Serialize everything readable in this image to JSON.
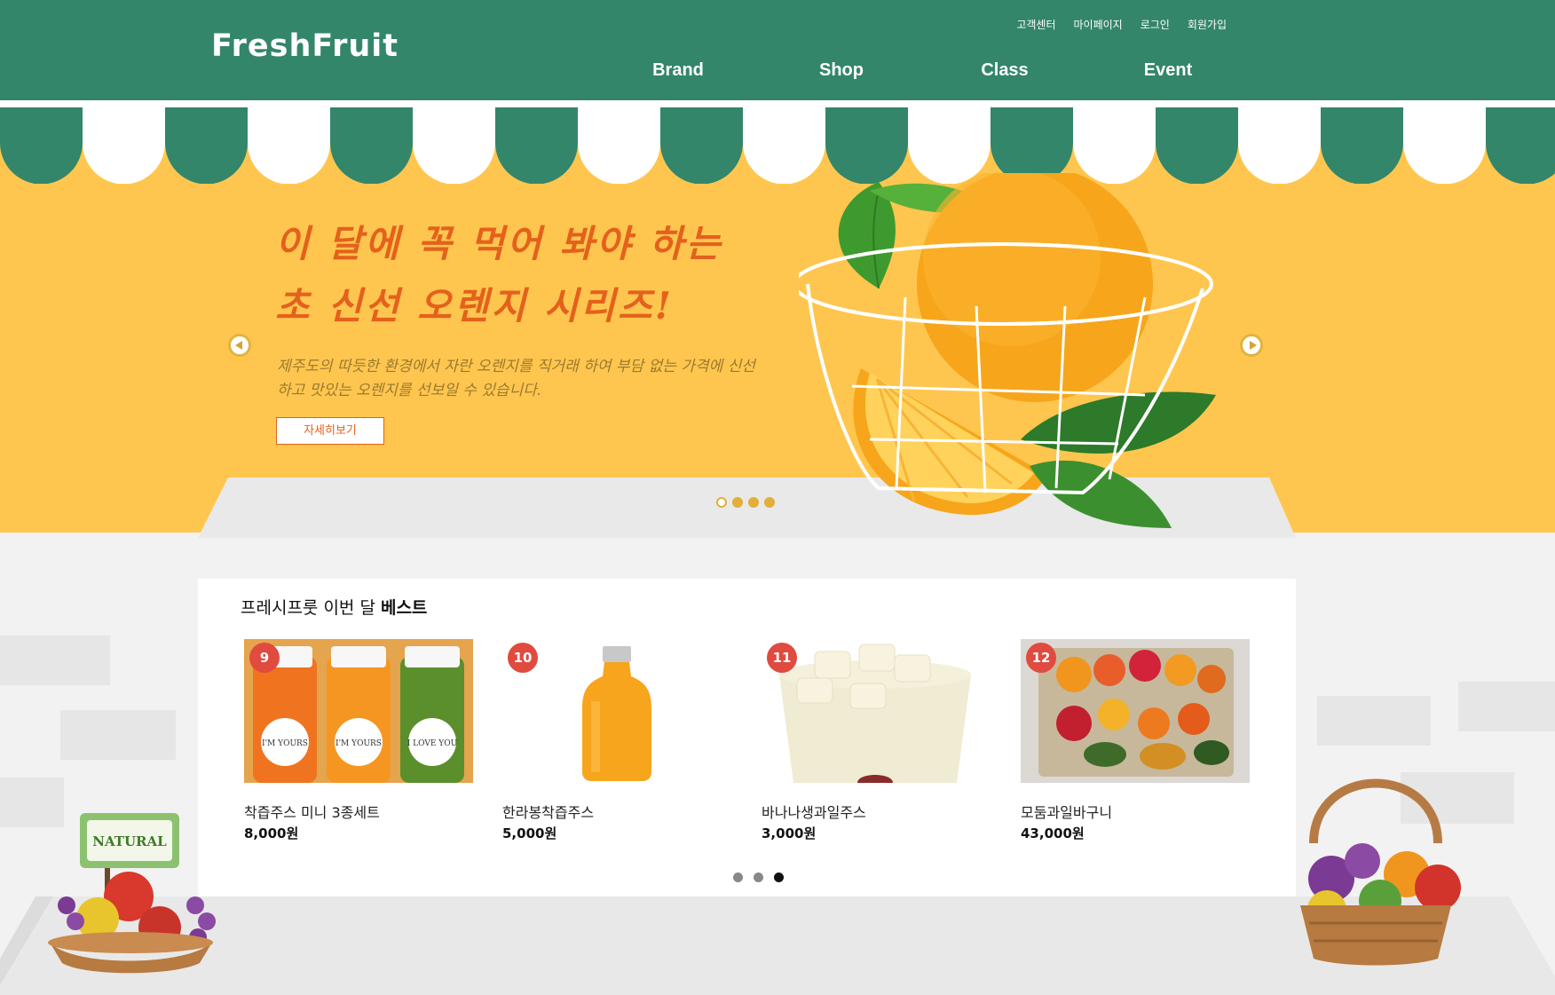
{
  "header": {
    "logo": "FreshFruit",
    "util_links": [
      "고객센터",
      "마이페이지",
      "로그인",
      "회원가입"
    ],
    "nav": [
      "Brand",
      "Shop",
      "Class",
      "Event"
    ]
  },
  "banner": {
    "headline_line1": "이 달에 꼭 먹어 봐야 하는",
    "headline_line2": "초 신선 오렌지 시리즈!",
    "description": "제주도의 따듯한 환경에서 자란 오렌지를 직거래 하여 부담 없는 가격에 신선하고 맛있는 오렌지를 선보일 수 있습니다.",
    "button": "자세히보기",
    "slide_count": 4,
    "active_slide": 1
  },
  "best": {
    "title_prefix": "프레시프룻 이번 달",
    "title_bold": "베스트",
    "products": [
      {
        "rank": "9",
        "name": "착즙주스 미니 3종세트",
        "price": "8,000원"
      },
      {
        "rank": "10",
        "name": "한라봉착즙주스",
        "price": "5,000원"
      },
      {
        "rank": "11",
        "name": "바나나생과일주스",
        "price": "3,000원"
      },
      {
        "rank": "12",
        "name": "모둠과일바구니",
        "price": "43,000원"
      }
    ],
    "bottle_labels": [
      "I'M YOURS",
      "I'M YOURS",
      "I LOVE YOU"
    ],
    "page_count": 3,
    "active_page": 3
  },
  "decor": {
    "sign_text": "NATURAL"
  },
  "colors": {
    "header_green": "#338669",
    "banner_yellow": "#ffc64f",
    "headline_orange": "#e4611c",
    "rank_red": "#e14a3f"
  }
}
